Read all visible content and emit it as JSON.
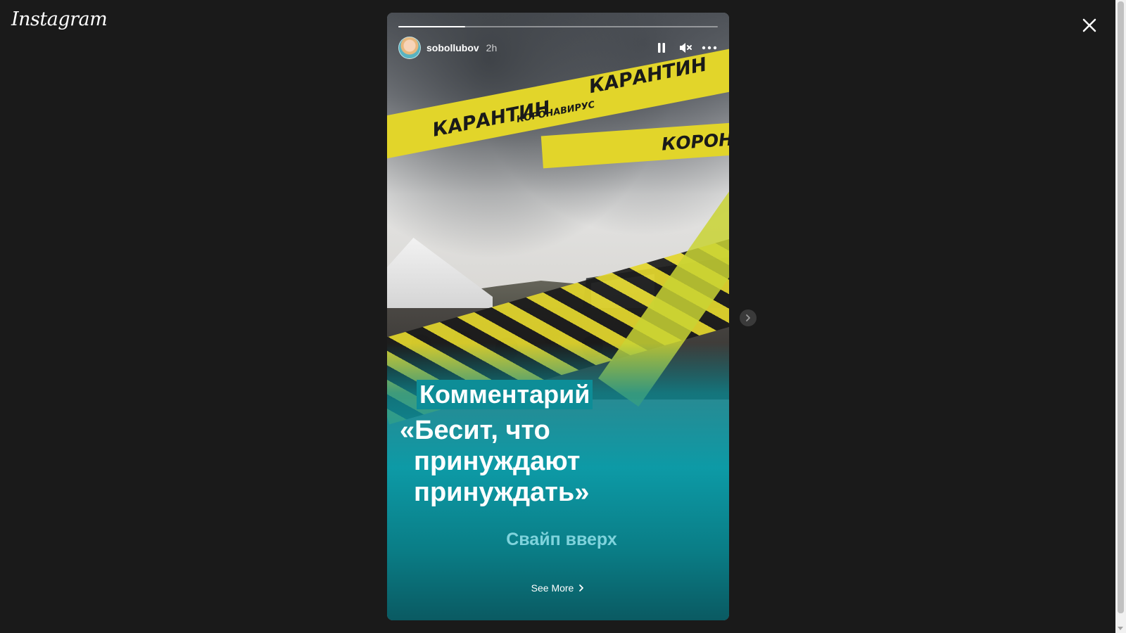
{
  "app": {
    "logo_text": "Instagram"
  },
  "story": {
    "progress_fraction": 0.21,
    "username": "sobollubov",
    "time_ago": "2h",
    "tape_texts": {
      "main_left": "КАРАНТИН",
      "main_right": "КАРАНТИН",
      "small": "КОРОНАВИРУС",
      "right": "КОРОНА"
    },
    "label": "Комментарий",
    "quote_lines": [
      "«Бесит, что",
      "принуждают",
      "принуждать»"
    ],
    "swipe_text": "Свайп вверх",
    "see_more": "See More"
  },
  "icons": {
    "close": "close-icon",
    "pause": "pause-icon",
    "mute": "mute-icon",
    "more": "more-icon",
    "next": "chevron-right-icon",
    "see_more_chevron": "chevron-right-icon"
  },
  "colors": {
    "background": "#1a1a1a",
    "teal": "#0d9aa6",
    "tape": "#e2d52a",
    "swipe": "#7fd3dc"
  }
}
